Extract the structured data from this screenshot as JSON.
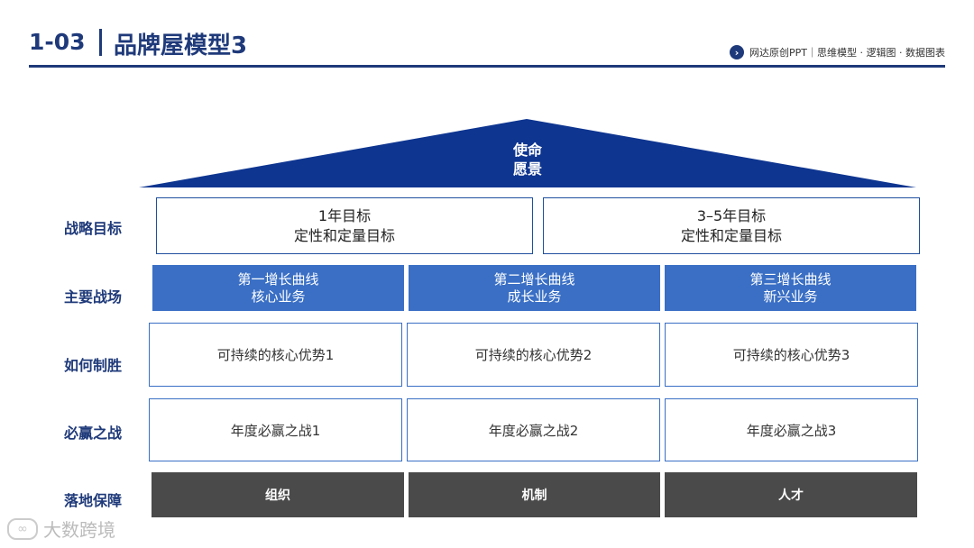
{
  "header": {
    "number": "1-03",
    "title": "品牌屋模型3",
    "tagline": "网达原创PPT｜思维模型 · 逻辑图 · 数据图表"
  },
  "roof": {
    "line1": "使命",
    "line2": "愿景"
  },
  "rows": {
    "goals": {
      "label": "战略目标",
      "items": [
        {
          "line1": "1年目标",
          "line2": "定性和定量目标"
        },
        {
          "line1": "3–5年目标",
          "line2": "定性和定量目标"
        }
      ]
    },
    "fields": {
      "label": "主要战场",
      "items": [
        {
          "line1": "第一增长曲线",
          "line2": "核心业务"
        },
        {
          "line1": "第二增长曲线",
          "line2": "成长业务"
        },
        {
          "line1": "第三增长曲线",
          "line2": "新兴业务"
        }
      ]
    },
    "advantages": {
      "label": "如何制胜",
      "items": [
        "可持续的核心优势1",
        "可持续的核心优势2",
        "可持续的核心优势3"
      ]
    },
    "battles": {
      "label": "必赢之战",
      "items": [
        "年度必赢之战1",
        "年度必赢之战2",
        "年度必赢之战3"
      ]
    },
    "guarantees": {
      "label": "落地保障",
      "items": [
        "组织",
        "机制",
        "人才"
      ]
    }
  },
  "watermark": {
    "text": "大数跨境",
    "icon": "logo-icon"
  },
  "colors": {
    "primary": "#1f3a7a",
    "roof": "#0e3590",
    "field": "#3a6fc5",
    "guarantee": "#4a4a4a"
  }
}
